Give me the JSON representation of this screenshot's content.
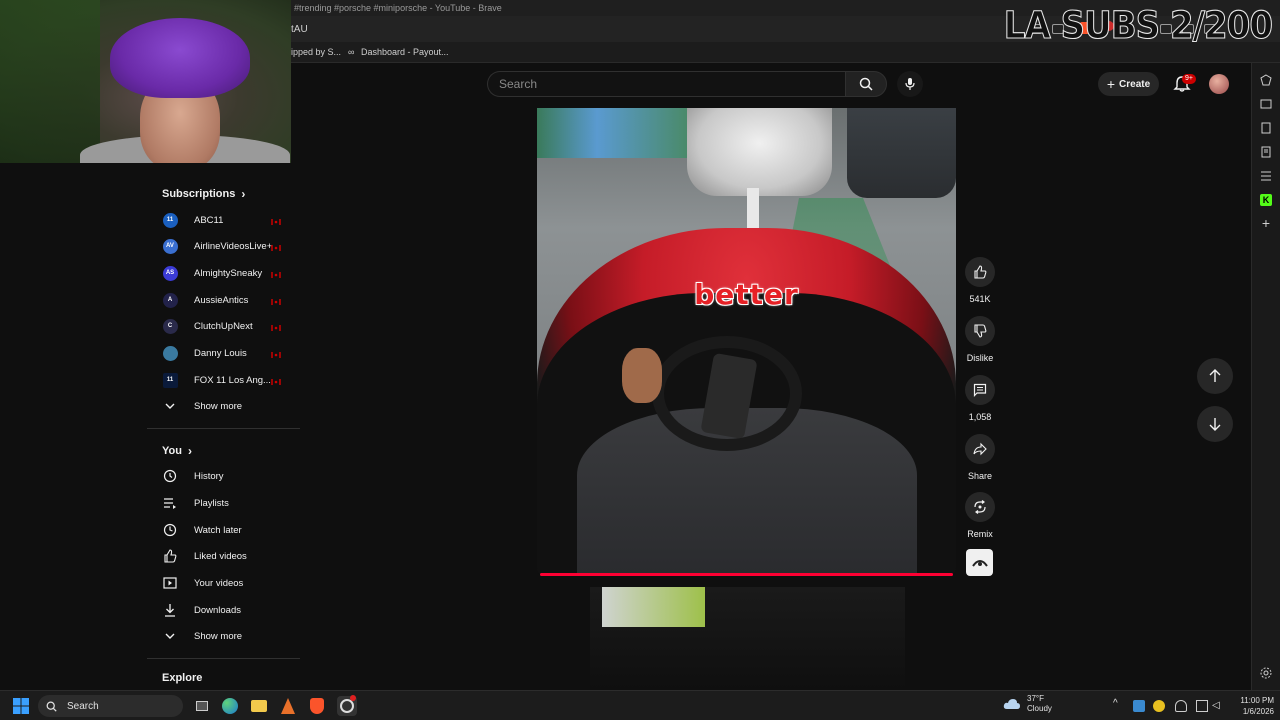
{
  "browser": {
    "window_title": "#trending #porsche #miniporsche - YouTube - Brave",
    "tab_title": "tAU",
    "bookmarks": [
      "ipped by S...",
      "Dashboard - Payout..."
    ]
  },
  "watermark": "LA SUBS 2/200",
  "header": {
    "search_placeholder": "Search",
    "create_label": "Create",
    "notification_count": "9+"
  },
  "sidebar": {
    "subscriptions_label": "Subscriptions",
    "channels": [
      {
        "name": "ABC11",
        "color": "#1a5fbf",
        "mark": "11"
      },
      {
        "name": "AirlineVideosLive+",
        "color": "#3a6fd0",
        "mark": "AV"
      },
      {
        "name": "AlmightySneaky",
        "color": "#3b3bd6",
        "mark": "AS"
      },
      {
        "name": "AussieAntics",
        "color": "#22224a",
        "mark": "A"
      },
      {
        "name": "ClutchUpNext",
        "color": "#2a2a4a",
        "mark": "C"
      },
      {
        "name": "Danny Louis",
        "color": "#3a7aa0",
        "mark": ""
      },
      {
        "name": "FOX 11 Los Ang...",
        "color": "#0a1a3a",
        "mark": "11"
      }
    ],
    "show_more_1": "Show more",
    "you_label": "You",
    "you_items": [
      {
        "label": "History",
        "icon": "history-icon"
      },
      {
        "label": "Playlists",
        "icon": "playlists-icon"
      },
      {
        "label": "Watch later",
        "icon": "watch-later-icon"
      },
      {
        "label": "Liked videos",
        "icon": "liked-videos-icon"
      },
      {
        "label": "Your videos",
        "icon": "your-videos-icon"
      },
      {
        "label": "Downloads",
        "icon": "downloads-icon"
      }
    ],
    "show_more_2": "Show more",
    "explore_label": "Explore"
  },
  "video": {
    "caption": "better",
    "progress": 1.0
  },
  "actions": {
    "likes": "541K",
    "dislike": "Dislike",
    "comments": "1,058",
    "share": "Share",
    "remix": "Remix"
  },
  "taskbar": {
    "search_label": "Search",
    "weather_temp": "37°F",
    "weather_cond": "Cloudy",
    "time": "11:00 PM",
    "date": "1/6/2026"
  },
  "colors": {
    "accent_red": "#ff0033",
    "live_red": "#cc0000",
    "background": "#0f0f0f"
  }
}
